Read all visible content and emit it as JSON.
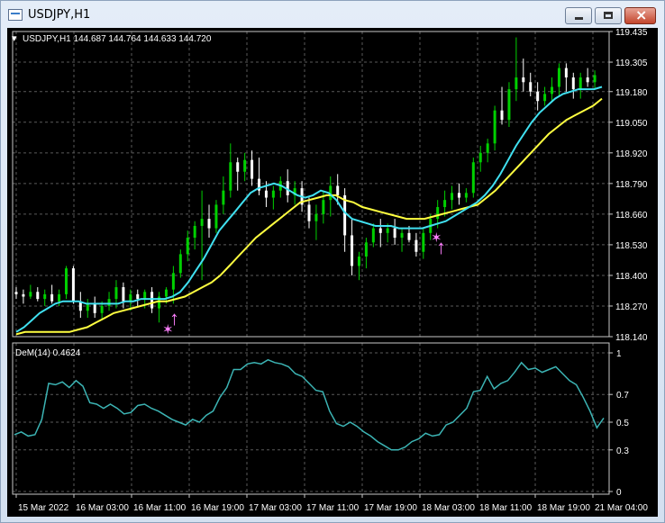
{
  "window": {
    "title": "USDJPY,H1",
    "minimize_icon": "minimize-icon",
    "maximize_icon": "maximize-icon",
    "close_icon": "close-icon"
  },
  "main_chart": {
    "header": "USDJPY,H1  144.687 144.764 144.633 144.720",
    "header_icon": "triangle-down-icon",
    "price_labels": [
      "119.435",
      "119.305",
      "119.180",
      "119.050",
      "118.920",
      "118.790",
      "118.660",
      "118.530",
      "118.400",
      "118.270",
      "118.140"
    ],
    "arrow_icon": "up-arrow-icon",
    "star_icon": "star-icon"
  },
  "indicator": {
    "header": "DeM(14) 0.4624",
    "levels": [
      "1",
      "0.7",
      "0.5",
      "0.3",
      "0"
    ]
  },
  "time_labels": [
    "15 Mar 2022",
    "16 Mar 03:00",
    "16 Mar 11:00",
    "16 Mar 19:00",
    "17 Mar 03:00",
    "17 Mar 11:00",
    "17 Mar 19:00",
    "18 Mar 03:00",
    "18 Mar 11:00",
    "18 Mar 19:00",
    "21 Mar 04:00"
  ],
  "colors": {
    "background": "#000000",
    "grid": "#5a5a5a",
    "bull_candle": "#00d000",
    "bear_candle": "#ffffff",
    "fast_ma": "#40e0f0",
    "slow_ma": "#ffff40",
    "dem_line": "#3cb4b4",
    "signal": "#ff80ff",
    "text": "#ffffff"
  },
  "chart_data": {
    "type": "candlestick",
    "symbol": "USDJPY",
    "timeframe": "H1",
    "y_range": [
      118.14,
      119.435
    ],
    "candles": [
      [
        118.33,
        118.35,
        118.3,
        118.32
      ],
      [
        118.32,
        118.34,
        118.28,
        118.31
      ],
      [
        118.31,
        118.36,
        118.3,
        118.33
      ],
      [
        118.33,
        118.35,
        118.29,
        118.3
      ],
      [
        118.3,
        118.34,
        118.27,
        118.32
      ],
      [
        118.32,
        118.36,
        118.28,
        118.29
      ],
      [
        118.29,
        118.34,
        118.27,
        118.32
      ],
      [
        118.32,
        118.44,
        118.3,
        118.43
      ],
      [
        118.43,
        118.44,
        118.28,
        118.29
      ],
      [
        118.29,
        118.33,
        118.22,
        118.25
      ],
      [
        118.25,
        118.3,
        118.22,
        118.28
      ],
      [
        118.28,
        118.31,
        118.22,
        118.24
      ],
      [
        118.24,
        118.29,
        118.21,
        118.27
      ],
      [
        118.27,
        118.33,
        118.25,
        118.3
      ],
      [
        118.3,
        118.38,
        118.26,
        118.35
      ],
      [
        118.35,
        118.37,
        118.26,
        118.29
      ],
      [
        118.29,
        118.34,
        118.25,
        118.32
      ],
      [
        118.32,
        118.34,
        118.27,
        118.3
      ],
      [
        118.3,
        118.34,
        118.26,
        118.33
      ],
      [
        118.33,
        118.35,
        118.24,
        118.26
      ],
      [
        118.26,
        118.33,
        118.2,
        118.31
      ],
      [
        118.31,
        118.35,
        118.28,
        118.34
      ],
      [
        118.34,
        118.44,
        118.28,
        118.41
      ],
      [
        118.41,
        118.51,
        118.39,
        118.49
      ],
      [
        118.49,
        118.59,
        118.46,
        118.56
      ],
      [
        118.56,
        118.63,
        118.51,
        118.61
      ],
      [
        118.61,
        118.76,
        118.38,
        118.64
      ],
      [
        118.64,
        118.7,
        118.56,
        118.6
      ],
      [
        118.6,
        118.72,
        118.58,
        118.7
      ],
      [
        118.7,
        118.82,
        118.66,
        118.76
      ],
      [
        118.76,
        118.96,
        118.73,
        118.88
      ],
      [
        118.88,
        118.9,
        118.76,
        118.84
      ],
      [
        118.84,
        118.92,
        118.8,
        118.89
      ],
      [
        118.89,
        118.93,
        118.78,
        118.81
      ],
      [
        118.81,
        118.9,
        118.74,
        118.76
      ],
      [
        118.76,
        118.8,
        118.69,
        118.73
      ],
      [
        118.73,
        118.78,
        118.68,
        118.76
      ],
      [
        118.76,
        118.82,
        118.73,
        118.8
      ],
      [
        118.8,
        118.85,
        118.71,
        118.74
      ],
      [
        118.74,
        118.8,
        118.7,
        118.77
      ],
      [
        118.77,
        118.8,
        118.67,
        118.7
      ],
      [
        118.7,
        118.73,
        118.6,
        118.63
      ],
      [
        118.63,
        118.7,
        118.55,
        118.66
      ],
      [
        118.66,
        118.76,
        118.62,
        118.72
      ],
      [
        118.72,
        118.82,
        118.65,
        118.78
      ],
      [
        118.78,
        118.83,
        118.7,
        118.74
      ],
      [
        118.74,
        118.77,
        118.5,
        118.57
      ],
      [
        118.57,
        118.64,
        118.4,
        118.44
      ],
      [
        118.44,
        118.5,
        118.38,
        118.48
      ],
      [
        118.48,
        118.56,
        118.43,
        118.54
      ],
      [
        118.54,
        118.62,
        118.52,
        118.6
      ],
      [
        118.6,
        118.64,
        118.52,
        118.58
      ],
      [
        118.58,
        118.62,
        118.54,
        118.6
      ],
      [
        118.6,
        118.64,
        118.53,
        118.56
      ],
      [
        118.56,
        118.6,
        118.5,
        118.58
      ],
      [
        118.58,
        118.61,
        118.54,
        118.55
      ],
      [
        118.55,
        118.58,
        118.48,
        118.5
      ],
      [
        118.5,
        118.6,
        118.47,
        118.58
      ],
      [
        118.58,
        118.66,
        118.55,
        118.64
      ],
      [
        118.64,
        118.72,
        118.6,
        118.69
      ],
      [
        118.69,
        118.76,
        118.65,
        118.72
      ],
      [
        118.72,
        118.78,
        118.68,
        118.75
      ],
      [
        118.75,
        118.79,
        118.7,
        118.73
      ],
      [
        118.73,
        118.77,
        118.71,
        118.75
      ],
      [
        118.75,
        118.9,
        118.73,
        118.88
      ],
      [
        118.88,
        118.95,
        118.84,
        118.92
      ],
      [
        118.92,
        118.98,
        118.88,
        118.96
      ],
      [
        118.96,
        119.12,
        118.93,
        119.1
      ],
      [
        119.1,
        119.2,
        119.04,
        119.06
      ],
      [
        119.06,
        119.22,
        119.03,
        119.19
      ],
      [
        119.19,
        119.41,
        119.14,
        119.24
      ],
      [
        119.24,
        119.32,
        119.18,
        119.22
      ],
      [
        119.22,
        119.26,
        119.16,
        119.18
      ],
      [
        119.18,
        119.22,
        119.1,
        119.14
      ],
      [
        119.14,
        119.2,
        119.12,
        119.17
      ],
      [
        119.17,
        119.24,
        119.14,
        119.2
      ],
      [
        119.2,
        119.3,
        119.16,
        119.28
      ],
      [
        119.28,
        119.3,
        119.18,
        119.24
      ],
      [
        119.24,
        119.26,
        119.15,
        119.19
      ],
      [
        119.19,
        119.26,
        119.15,
        119.24
      ],
      [
        119.24,
        119.28,
        119.2,
        119.22
      ],
      [
        119.22,
        119.27,
        119.19,
        119.25
      ]
    ],
    "fast_ma": [
      118.16,
      118.18,
      118.21,
      118.24,
      118.26,
      118.28,
      118.29,
      118.29,
      118.29,
      118.28,
      118.28,
      118.28,
      118.28,
      118.28,
      118.29,
      118.29,
      118.3,
      118.3,
      118.3,
      118.3,
      118.31,
      118.33,
      118.37,
      118.42,
      118.47,
      118.53,
      118.59,
      118.63,
      118.67,
      118.71,
      118.75,
      118.77,
      118.78,
      118.79,
      118.78,
      118.76,
      118.74,
      118.73,
      118.74,
      118.76,
      118.75,
      118.72,
      118.67,
      118.64,
      118.63,
      118.62,
      118.61,
      118.61,
      118.61,
      118.6,
      118.6,
      118.6,
      118.6,
      118.61,
      118.62,
      118.63,
      118.65,
      118.67,
      118.69,
      118.71,
      118.74,
      118.78,
      118.83,
      118.89,
      118.95,
      119.0,
      119.05,
      119.09,
      119.12,
      119.15,
      119.17,
      119.18,
      119.19,
      119.19,
      119.19,
      119.2
    ],
    "slow_ma": [
      118.15,
      118.16,
      118.16,
      118.16,
      118.16,
      118.16,
      118.16,
      118.17,
      118.18,
      118.2,
      118.22,
      118.24,
      118.25,
      118.26,
      118.27,
      118.28,
      118.29,
      118.29,
      118.3,
      118.31,
      118.33,
      118.35,
      118.37,
      118.4,
      118.44,
      118.48,
      118.52,
      118.56,
      118.59,
      118.62,
      118.65,
      118.68,
      118.71,
      118.72,
      118.73,
      118.74,
      118.74,
      118.72,
      118.71,
      118.69,
      118.68,
      118.67,
      118.66,
      118.65,
      118.64,
      118.64,
      118.64,
      118.65,
      118.66,
      118.67,
      118.68,
      118.69,
      118.7,
      118.73,
      118.76,
      118.8,
      118.84,
      118.88,
      118.92,
      118.96,
      119.0,
      119.03,
      119.06,
      119.08,
      119.1,
      119.12,
      119.15
    ],
    "dem": [
      0.41,
      0.43,
      0.4,
      0.41,
      0.52,
      0.78,
      0.77,
      0.79,
      0.75,
      0.8,
      0.76,
      0.64,
      0.63,
      0.6,
      0.63,
      0.6,
      0.56,
      0.57,
      0.62,
      0.63,
      0.6,
      0.58,
      0.55,
      0.52,
      0.5,
      0.48,
      0.52,
      0.5,
      0.55,
      0.58,
      0.68,
      0.75,
      0.88,
      0.88,
      0.92,
      0.93,
      0.92,
      0.95,
      0.93,
      0.92,
      0.9,
      0.85,
      0.83,
      0.78,
      0.73,
      0.72,
      0.58,
      0.49,
      0.47,
      0.5,
      0.47,
      0.43,
      0.4,
      0.36,
      0.33,
      0.3,
      0.3,
      0.32,
      0.36,
      0.38,
      0.42,
      0.4,
      0.41,
      0.48,
      0.5,
      0.55,
      0.6,
      0.72,
      0.73,
      0.83,
      0.74,
      0.78,
      0.8,
      0.86,
      0.93,
      0.88,
      0.89,
      0.86,
      0.88,
      0.9,
      0.85,
      0.8,
      0.77,
      0.68,
      0.58,
      0.46,
      0.53
    ],
    "dem_levels": [
      0,
      0.3,
      0.5,
      0.7,
      1
    ]
  }
}
